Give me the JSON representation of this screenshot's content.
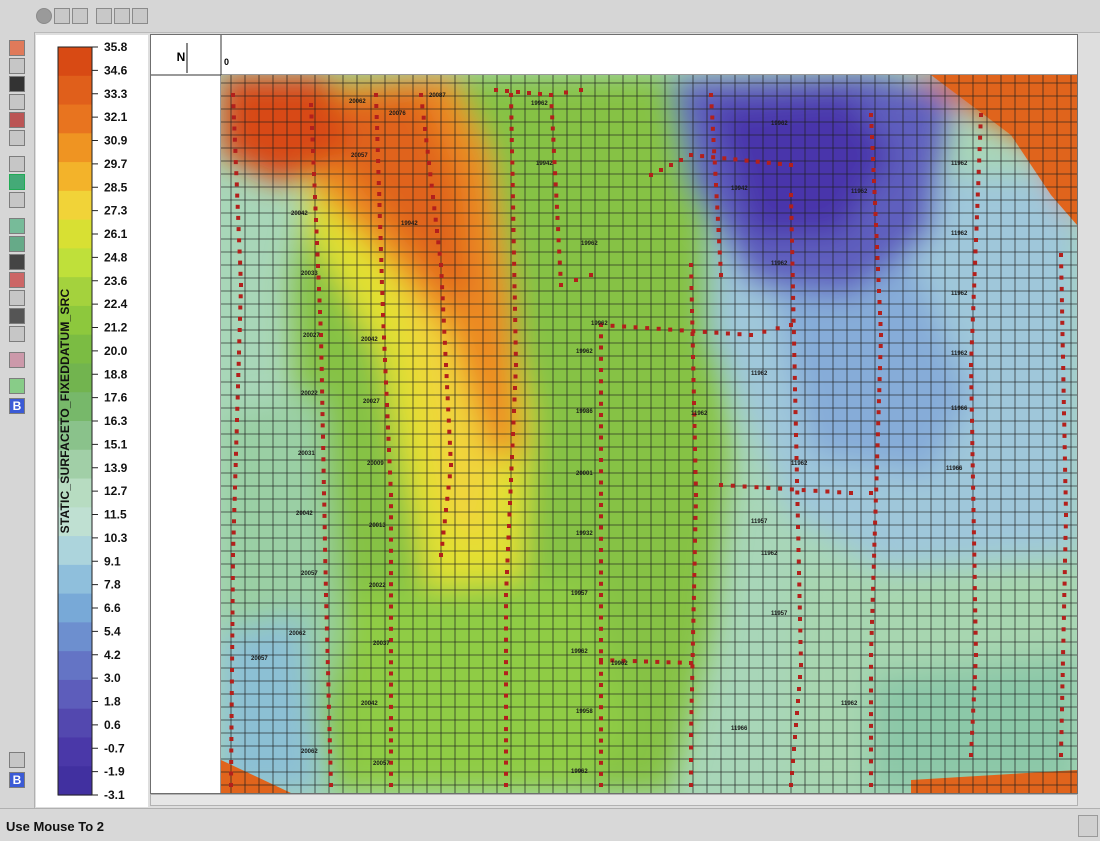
{
  "legend": {
    "title": "STATIC_SURFACETO_FIXEDDATUM_SRC",
    "ticks": [
      "35.8",
      "34.6",
      "33.3",
      "32.1",
      "30.9",
      "29.7",
      "28.5",
      "27.3",
      "26.1",
      "24.8",
      "23.6",
      "22.4",
      "21.2",
      "20.0",
      "18.8",
      "17.6",
      "16.3",
      "15.1",
      "13.9",
      "12.7",
      "11.5",
      "10.3",
      "9.1",
      "7.8",
      "6.6",
      "5.4",
      "4.2",
      "3.0",
      "1.8",
      "0.6",
      "-0.7",
      "-1.9",
      "-3.1"
    ],
    "colors": [
      "#d84a14",
      "#e05f1b",
      "#e8741f",
      "#ef9422",
      "#f3b32a",
      "#f1d338",
      "#d8e033",
      "#bfe03a",
      "#a4d23d",
      "#8dc83d",
      "#7bbc43",
      "#72b44f",
      "#77b86a",
      "#8ac28b",
      "#a1cfa7",
      "#b7dcc1",
      "#bfe0d2",
      "#acd4dc",
      "#8fbfdc",
      "#78a9d7",
      "#6d8fcf",
      "#6474c5",
      "#5d5dbb",
      "#5348af",
      "#4a38a8",
      "#4130a0"
    ]
  },
  "compass": {
    "north": "N"
  },
  "axis_start": "0",
  "status": {
    "message": "Use Mouse To 2"
  },
  "station_labels": [
    "20062",
    "20076",
    "20087",
    "20057",
    "20042",
    "20033",
    "20027",
    "20022",
    "20031",
    "20042",
    "20057",
    "20062",
    "20057",
    "20042",
    "20027",
    "20009",
    "20013",
    "20022",
    "20037",
    "20042",
    "20057",
    "20062",
    "19962",
    "19986",
    "20001",
    "19932",
    "19957",
    "19962",
    "19958",
    "19962",
    "19962",
    "19962",
    "19942",
    "19962",
    "19942",
    "19962",
    "19962",
    "19942",
    "11962",
    "11962",
    "11962",
    "11962",
    "11962",
    "11957",
    "11962",
    "11957",
    "11966",
    "11962",
    "11962",
    "11962",
    "11962",
    "11962",
    "11966",
    "11966"
  ]
}
